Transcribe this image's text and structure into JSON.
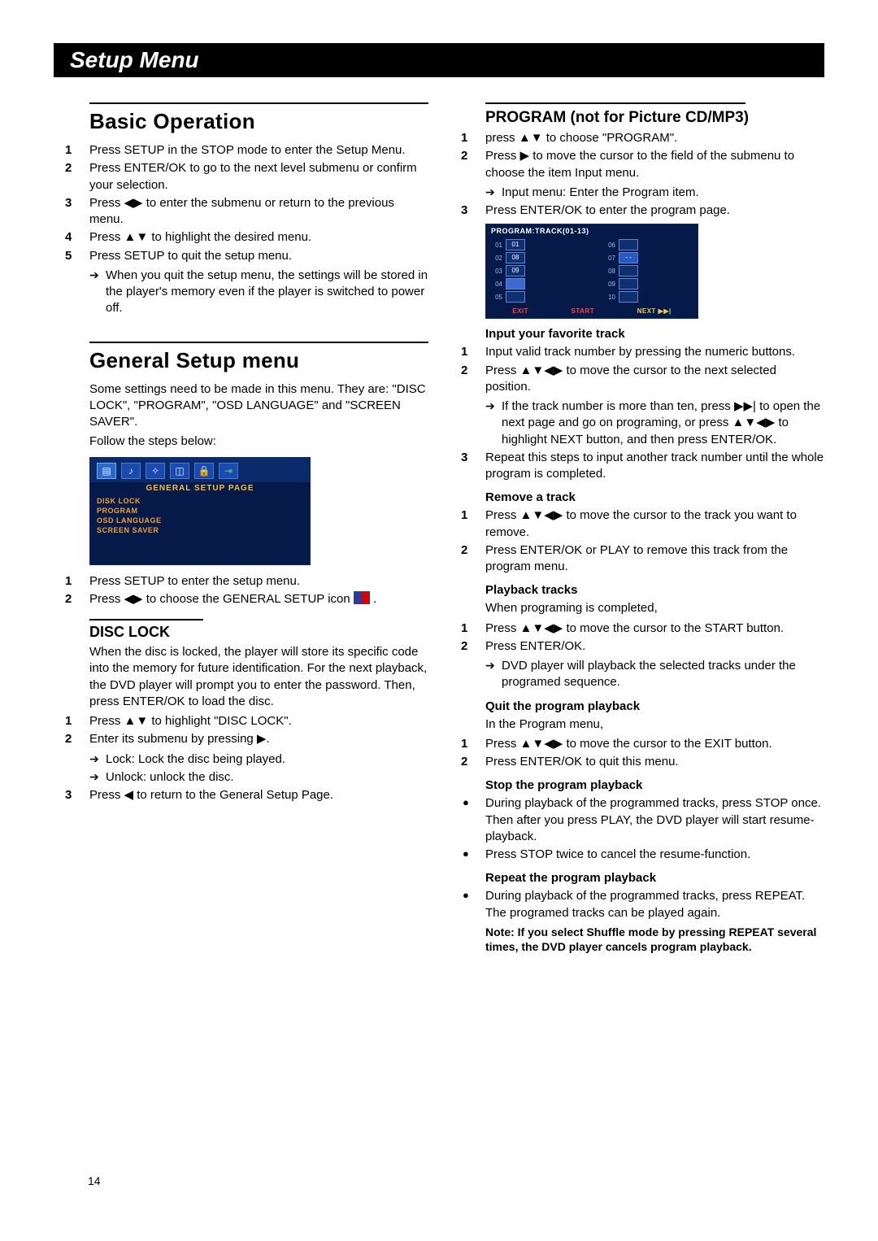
{
  "page_number": "14",
  "header": "Setup Menu",
  "left": {
    "basic_operation": {
      "title": "Basic Operation",
      "steps": [
        {
          "n": "1",
          "t": "Press SETUP in the STOP mode to enter the Setup Menu."
        },
        {
          "n": "2",
          "t": "Press ENTER/OK to go to the next level submenu or confirm your selection."
        },
        {
          "n": "3",
          "t": "Press ◀▶ to enter the submenu or return to the previous menu."
        },
        {
          "n": "4",
          "t": "Press ▲▼ to highlight the desired menu."
        },
        {
          "n": "5",
          "t": "Press SETUP to quit the setup menu."
        }
      ],
      "arrow": "When you quit the setup menu, the settings will be stored in the player's memory even if the player is switched to power off."
    },
    "general_setup": {
      "title": "General Setup menu",
      "intro": "Some settings need to be made in this menu. They are: \"DISC LOCK\", \"PROGRAM\", \"OSD LANGUAGE\" and \"SCREEN SAVER\".",
      "follow": "Follow the steps below:",
      "osd": {
        "title": "GENERAL  SETUP  PAGE",
        "items": [
          "DISK  LOCK",
          "PROGRAM",
          "OSD  LANGUAGE",
          "SCREEN  SAVER"
        ]
      },
      "steps": [
        {
          "n": "1",
          "t": "Press SETUP to enter the setup menu."
        },
        {
          "n": "2",
          "t": "Press ◀▶ to choose the GENERAL SETUP icon "
        }
      ]
    },
    "disc_lock": {
      "title": "DISC LOCK",
      "intro": "When the disc is locked, the player will store its specific code into the memory for future identification. For the next playback, the DVD player will prompt you to enter the password. Then, press ENTER/OK to load the disc.",
      "steps": [
        {
          "n": "1",
          "t": "Press ▲▼ to highlight \"DISC LOCK\"."
        },
        {
          "n": "2",
          "t": "Enter its submenu by pressing ▶."
        }
      ],
      "arrows": [
        "Lock: Lock the disc being played.",
        "Unlock: unlock the disc."
      ],
      "step3": {
        "n": "3",
        "t": "Press ◀ to return to the General Setup Page."
      }
    }
  },
  "right": {
    "program": {
      "title": "PROGRAM (not for Picture CD/MP3)",
      "steps": [
        {
          "n": "1",
          "t": "press ▲▼ to choose \"PROGRAM\"."
        },
        {
          "n": "2",
          "t": "Press ▶ to move the cursor to the field of the submenu to choose the item Input menu."
        }
      ],
      "arrow": "Input menu: Enter the Program item.",
      "step3": {
        "n": "3",
        "t": "Press ENTER/OK to enter the program page."
      },
      "osd": {
        "title": "PROGRAM:TRACK(01-13)",
        "left_idx": [
          "01",
          "02",
          "03",
          "04",
          "05"
        ],
        "left_val": [
          "01",
          "08",
          "09",
          "",
          ""
        ],
        "right_idx": [
          "06",
          "07",
          "08",
          "09",
          "10"
        ],
        "bottom": {
          "exit": "EXIT",
          "start": "START",
          "next": "NEXT ▶▶|"
        }
      }
    },
    "input_track": {
      "title": "Input your favorite track",
      "steps": [
        {
          "n": "1",
          "t": "Input valid track number by pressing the numeric buttons."
        },
        {
          "n": "2",
          "t": "Press ▲▼◀▶ to move the cursor to the next selected position."
        }
      ],
      "arrow": "If the track number is more than ten, press ▶▶| to open the next page and go on programing, or press ▲▼◀▶ to highlight NEXT button, and then press ENTER/OK.",
      "step3": {
        "n": "3",
        "t": "Repeat this steps to input another track number until the whole program is completed."
      }
    },
    "remove": {
      "title": "Remove a track",
      "steps": [
        {
          "n": "1",
          "t": "Press ▲▼◀▶ to move the cursor to the track you want to remove."
        },
        {
          "n": "2",
          "t": "Press ENTER/OK or PLAY to remove this track from the program menu."
        }
      ]
    },
    "playback": {
      "title": "Playback tracks",
      "intro": "When programing is completed,",
      "steps": [
        {
          "n": "1",
          "t": "Press ▲▼◀▶ to move the cursor to the START button."
        },
        {
          "n": "2",
          "t": "Press ENTER/OK."
        }
      ],
      "arrow": "DVD player will playback the selected tracks under the programed sequence."
    },
    "quit": {
      "title": "Quit the program playback",
      "intro": "In the Program menu,",
      "steps": [
        {
          "n": "1",
          "t": "Press ▲▼◀▶ to move the cursor to the EXIT button."
        },
        {
          "n": "2",
          "t": "Press ENTER/OK to quit this menu."
        }
      ]
    },
    "stop": {
      "title": "Stop the program playback",
      "bullets": [
        "During playback of the programmed tracks, press STOP once. Then after you press PLAY, the DVD player will start resume-playback.",
        "Press STOP twice to cancel the resume-function."
      ]
    },
    "repeat": {
      "title": "Repeat the program playback",
      "bullet": "During playback of the programmed tracks, press REPEAT. The programed tracks can be played again.",
      "note": "Note: If you select Shuffle mode by pressing REPEAT several times, the DVD player cancels program playback."
    }
  }
}
